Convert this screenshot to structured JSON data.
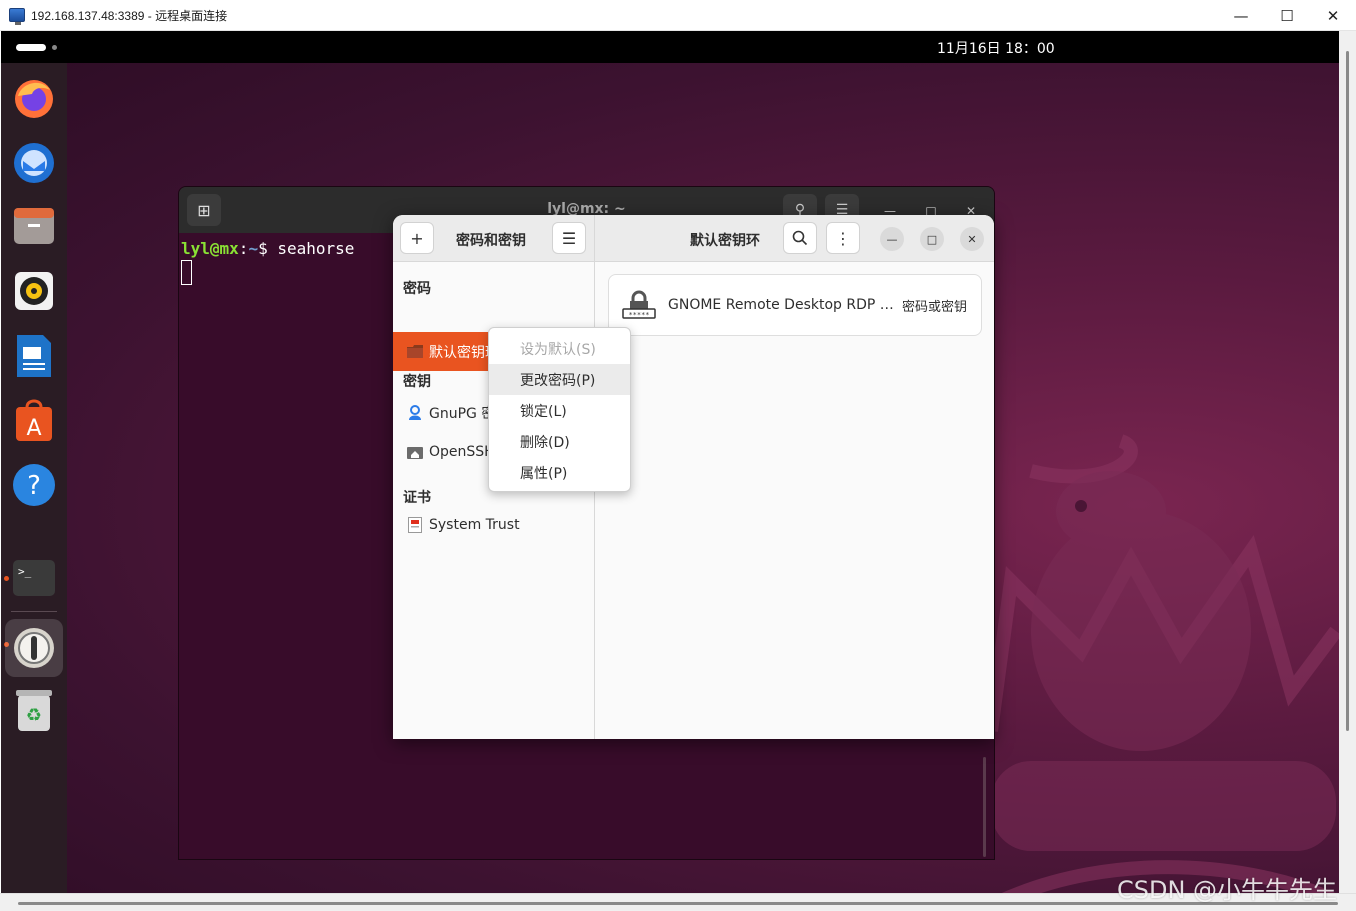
{
  "rdp": {
    "title": "192.168.137.48:3389 - 远程桌面连接",
    "controls": [
      "minimize",
      "maximize",
      "close"
    ]
  },
  "topbar": {
    "clock": "11月16日 18：00"
  },
  "dock": {
    "items": [
      {
        "name": "firefox-icon"
      },
      {
        "name": "thunderbird-icon"
      },
      {
        "name": "files-icon"
      },
      {
        "name": "rhythmbox-icon"
      },
      {
        "name": "libreoffice-writer-icon"
      },
      {
        "name": "app-center-icon"
      },
      {
        "name": "help-icon"
      },
      {
        "name": "terminal-icon",
        "running": true
      },
      {
        "name": "seahorse-icon",
        "running": true,
        "focused": true
      },
      {
        "name": "trash-icon"
      }
    ]
  },
  "terminal": {
    "title": "lyl@mx: ~",
    "prompt_user": "lyl@mx",
    "prompt_sep": ":",
    "prompt_path": "~",
    "prompt_symbol": "$",
    "command": "seahorse"
  },
  "seahorse": {
    "sidebar_title": "密码和密钥",
    "main_title": "默认密钥环",
    "sections": {
      "passwords": "密码",
      "keys": "密钥",
      "certificates": "证书"
    },
    "password_items": [
      {
        "label": "默认密钥环",
        "selected": true
      }
    ],
    "key_items": [
      {
        "label": "GnuPG 密"
      },
      {
        "label": "OpenSSH"
      }
    ],
    "cert_items": [
      {
        "label": "System Trust"
      }
    ],
    "entries": [
      {
        "name": "GNOME Remote Desktop RDP cr…",
        "type": "密码或密钥"
      }
    ]
  },
  "context_menu": {
    "items": [
      {
        "label": "设为默认(S)",
        "disabled": true
      },
      {
        "label": "更改密码(P)",
        "hover": true
      },
      {
        "label": "锁定(L)"
      },
      {
        "label": "删除(D)"
      },
      {
        "label": "属性(P)"
      }
    ]
  },
  "watermark": "CSDN @小牛牛先生",
  "colors": {
    "accent": "#e95420",
    "terminal_bg": "#380c2a",
    "prompt_user": "#8ae234",
    "prompt_path": "#729fcf"
  }
}
